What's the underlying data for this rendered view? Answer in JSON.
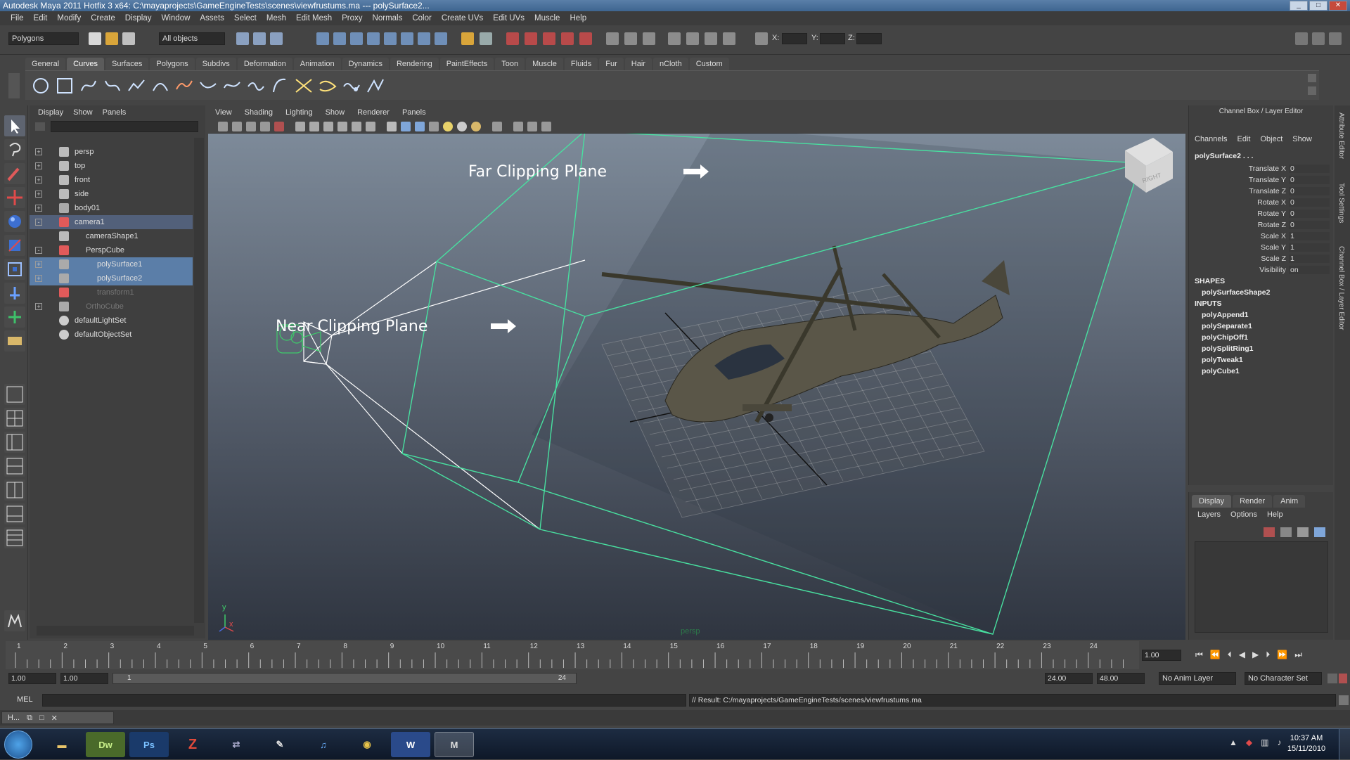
{
  "window": {
    "title": "Autodesk Maya 2011 Hotfix 3 x64: C:\\mayaprojects\\GameEngineTests\\scenes\\viewfrustums.ma   ---   polySurface2..."
  },
  "menubar": [
    "File",
    "Edit",
    "Modify",
    "Create",
    "Display",
    "Window",
    "Assets",
    "Select",
    "Mesh",
    "Edit Mesh",
    "Proxy",
    "Normals",
    "Color",
    "Create UVs",
    "Edit UVs",
    "Muscle",
    "Help"
  ],
  "statusline": {
    "menuset": "Polygons",
    "selection_mask": "All objects",
    "x_label": "X:",
    "y_label": "Y:",
    "z_label": "Z:"
  },
  "shelf": {
    "tabs": [
      "General",
      "Curves",
      "Surfaces",
      "Polygons",
      "Subdivs",
      "Deformation",
      "Animation",
      "Dynamics",
      "Rendering",
      "PaintEffects",
      "Toon",
      "Muscle",
      "Fluids",
      "Fur",
      "Hair",
      "nCloth",
      "Custom"
    ],
    "active_tab": "Curves"
  },
  "outliner": {
    "menu": [
      "Display",
      "Show",
      "Panels"
    ],
    "rows": [
      {
        "label": "persp",
        "depth": 0,
        "expand": "+",
        "icon": "camera-icon",
        "state": "normal"
      },
      {
        "label": "top",
        "depth": 0,
        "expand": "+",
        "icon": "camera-icon",
        "state": "normal"
      },
      {
        "label": "front",
        "depth": 0,
        "expand": "+",
        "icon": "camera-icon",
        "state": "normal"
      },
      {
        "label": "side",
        "depth": 0,
        "expand": "+",
        "icon": "camera-icon",
        "state": "normal"
      },
      {
        "label": "body01",
        "depth": 0,
        "expand": "+",
        "icon": "mesh-icon",
        "state": "normal"
      },
      {
        "label": "camera1",
        "depth": 0,
        "expand": "-",
        "icon": "transform-icon",
        "state": "camsel"
      },
      {
        "label": "cameraShape1",
        "depth": 1,
        "expand": "",
        "icon": "camera-icon",
        "state": "normal"
      },
      {
        "label": "PerspCube",
        "depth": 1,
        "expand": "-",
        "icon": "transform-icon",
        "state": "normal"
      },
      {
        "label": "polySurface1",
        "depth": 2,
        "expand": "+",
        "icon": "mesh-icon",
        "state": "sel"
      },
      {
        "label": "polySurface2",
        "depth": 2,
        "expand": "+",
        "icon": "mesh-icon",
        "state": "sel"
      },
      {
        "label": "transform1",
        "depth": 2,
        "expand": "",
        "icon": "transform-icon",
        "state": "dim"
      },
      {
        "label": "OrthoCube",
        "depth": 1,
        "expand": "+",
        "icon": "mesh-icon",
        "state": "dim"
      },
      {
        "label": "defaultLightSet",
        "depth": 0,
        "expand": "",
        "icon": "set-icon",
        "state": "normal"
      },
      {
        "label": "defaultObjectSet",
        "depth": 0,
        "expand": "",
        "icon": "set-icon",
        "state": "normal"
      }
    ]
  },
  "viewport": {
    "menu": [
      "View",
      "Shading",
      "Lighting",
      "Show",
      "Renderer",
      "Panels"
    ],
    "annotations": {
      "far": "Far Clipping Plane",
      "near": "Near Clipping Plane"
    },
    "viewcube_label": "RIGHT",
    "camera_name": "persp",
    "axis_y": "y",
    "axis_x": "x"
  },
  "channelbox": {
    "header": "Channel Box / Layer Editor",
    "menu": [
      "Channels",
      "Edit",
      "Object",
      "Show"
    ],
    "object": "polySurface2 . . .",
    "attributes": [
      {
        "name": "Translate X",
        "value": "0"
      },
      {
        "name": "Translate Y",
        "value": "0"
      },
      {
        "name": "Translate Z",
        "value": "0"
      },
      {
        "name": "Rotate X",
        "value": "0"
      },
      {
        "name": "Rotate Y",
        "value": "0"
      },
      {
        "name": "Rotate Z",
        "value": "0"
      },
      {
        "name": "Scale X",
        "value": "1"
      },
      {
        "name": "Scale Y",
        "value": "1"
      },
      {
        "name": "Scale Z",
        "value": "1"
      },
      {
        "name": "Visibility",
        "value": "on"
      }
    ],
    "shapes_label": "SHAPES",
    "shapes": [
      "polySurfaceShape2"
    ],
    "inputs_label": "INPUTS",
    "inputs": [
      "polyAppend1",
      "polySeparate1",
      "polyChipOff1",
      "polySplitRing1",
      "polyTweak1",
      "polyCube1"
    ]
  },
  "layers": {
    "tabs": [
      "Display",
      "Render",
      "Anim"
    ],
    "active_tab": "Display",
    "menu": [
      "Layers",
      "Options",
      "Help"
    ]
  },
  "sidetabs": [
    "Attribute Editor",
    "Tool Settings",
    "Channel Box / Layer Editor"
  ],
  "timeslider": {
    "ticks": [
      "1",
      "2",
      "3",
      "4",
      "5",
      "6",
      "7",
      "8",
      "9",
      "10",
      "11",
      "12",
      "13",
      "14",
      "15",
      "16",
      "17",
      "18",
      "19",
      "20",
      "21",
      "22",
      "23",
      "24"
    ],
    "current_frame": "1.00"
  },
  "rangeslider": {
    "start": "1.00",
    "playback_start": "1.00",
    "range_start_label": "1",
    "range_end_label": "24",
    "playback_end": "24.00",
    "end": "48.00",
    "anim_layer": "No Anim Layer",
    "character_set": "No Character Set"
  },
  "commandline": {
    "label": "MEL",
    "result": "// Result: C:/mayaprojects/GameEngineTests/scenes/viewfrustums.ma"
  },
  "taskbar": {
    "apps": [
      "Windows Explorer",
      "Dw",
      "Ps",
      "FileZilla",
      "Network",
      "Notepad",
      "iTunes",
      "Chrome",
      "W",
      "Maya"
    ],
    "time": "10:37 AM",
    "date": "15/11/2010",
    "minimized_label": "H..."
  },
  "colors": {
    "frustum": "#48e0a0",
    "selection": "#5b7ea8",
    "maya_bg": "#444444"
  }
}
